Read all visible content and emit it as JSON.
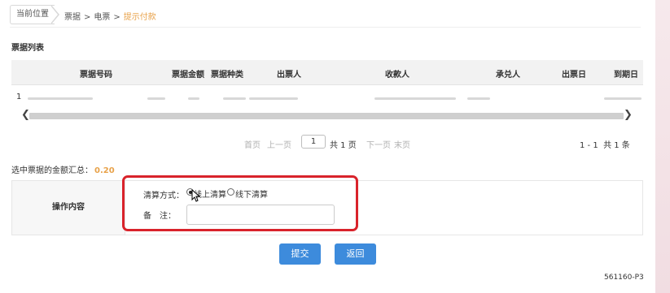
{
  "breadcrumb": {
    "label": "当前位置",
    "items": [
      "票据",
      "电票",
      "提示付款"
    ],
    "separator": ">"
  },
  "section_title": "票据列表",
  "table": {
    "headers": [
      "票据号码",
      "票据金额",
      "票据种类",
      "出票人",
      "收款人",
      "承兑人",
      "出票日",
      "到期日"
    ],
    "rows": [
      {
        "index": "1"
      }
    ]
  },
  "pager": {
    "first": "首页",
    "prev": "上一页",
    "page_value": "1",
    "total_pages": "共 1 页",
    "next": "下一页",
    "last": "末页",
    "record_range": "1 - 1",
    "record_total": "共 1 条"
  },
  "summary": {
    "label": "选中票据的金额汇总：",
    "amount": "0.20"
  },
  "operation": {
    "title": "操作内容",
    "method_label": "清算方式：",
    "options": [
      {
        "label": "线上清算",
        "checked": true
      },
      {
        "label": "线下清算",
        "checked": false
      }
    ],
    "remark_label": "备　注：",
    "remark_value": ""
  },
  "buttons": {
    "submit": "提交",
    "back": "返回"
  },
  "footer_code": "561160-P3",
  "colors": {
    "accent": "#e8a24a",
    "button": "#3d8bdc",
    "highlight": "#d9232b"
  }
}
